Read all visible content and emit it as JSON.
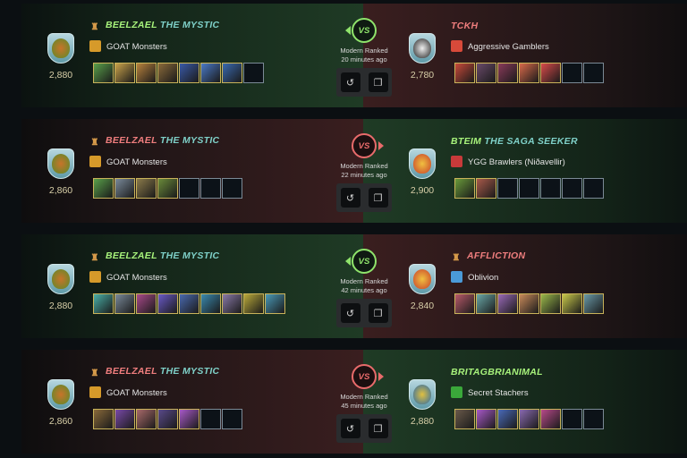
{
  "battles": [
    {
      "left_won": true,
      "left": {
        "name": "BEELZAEL",
        "title": "THE MYSTIC",
        "guild": "GOAT Monsters",
        "rating": "2,880",
        "cards": [
          "#5aa04a",
          "#c9a24a",
          "#b8823d",
          "#8a6a3a",
          "#3a5aa8",
          "#4a7ac8",
          "#3a6ab0"
        ],
        "slots": 8
      },
      "right": {
        "name": "TCKH",
        "title": "",
        "guild": "Aggressive Gamblers",
        "rating": "2,780",
        "cards": [
          "#c84a3a",
          "#6a4a6a",
          "#8a3a5a",
          "#d86a4a",
          "#d84a4a"
        ],
        "slots": 7
      },
      "mode": "Modern Ranked",
      "time": "20 minutes ago"
    },
    {
      "left_won": false,
      "left": {
        "name": "BEELZAEL",
        "title": "THE MYSTIC",
        "guild": "GOAT Monsters",
        "rating": "2,860",
        "cards": [
          "#5aa04a",
          "#7a8a9a",
          "#8a7a4a",
          "#6a8a3a"
        ],
        "slots": 7
      },
      "right": {
        "name": "BTEIM",
        "title": "THE SAGA SEEKER",
        "guild": "YGG Brawlers (Niðavellir)",
        "rating": "2,900",
        "cards": [
          "#6a9a3a",
          "#a85a4a"
        ],
        "slots": 7
      },
      "mode": "Modern Ranked",
      "time": "22 minutes ago"
    },
    {
      "left_won": true,
      "left": {
        "name": "BEELZAEL",
        "title": "THE MYSTIC",
        "guild": "GOAT Monsters",
        "rating": "2,880",
        "cards": [
          "#4ab0a8",
          "#7a8a9a",
          "#a84a8a",
          "#6a5ac8",
          "#4a6ab0",
          "#3a8ab0",
          "#8a7aa8",
          "#b8a83a",
          "#4a9ab8"
        ],
        "slots": 9
      },
      "right": {
        "name": "AFFLICTION",
        "title": "",
        "guild": "Oblivion",
        "rating": "2,840",
        "cards": [
          "#b85a6a",
          "#6aa8a8",
          "#9a6ab8",
          "#c88a5a",
          "#9ab84a",
          "#c8c84a",
          "#6a9aa8"
        ],
        "slots": 7
      },
      "mode": "Modern Ranked",
      "time": "42 minutes ago"
    },
    {
      "left_won": false,
      "left": {
        "name": "BEELZAEL",
        "title": "THE MYSTIC",
        "guild": "GOAT Monsters",
        "rating": "2,860",
        "cards": [
          "#8a6a3a",
          "#7a4aa8",
          "#a86a6a",
          "#5a4a8a",
          "#a85ac8"
        ],
        "slots": 7
      },
      "right": {
        "name": "BRITAGBRIANIMAL",
        "title": "",
        "guild": "Secret Stachers",
        "rating": "2,880",
        "cards": [
          "#6a5a4a",
          "#a85ac8",
          "#4a6ab8",
          "#8a6ab0",
          "#b84a8a"
        ],
        "slots": 7
      },
      "mode": "Modern Ranked",
      "time": "45 minutes ago"
    }
  ]
}
